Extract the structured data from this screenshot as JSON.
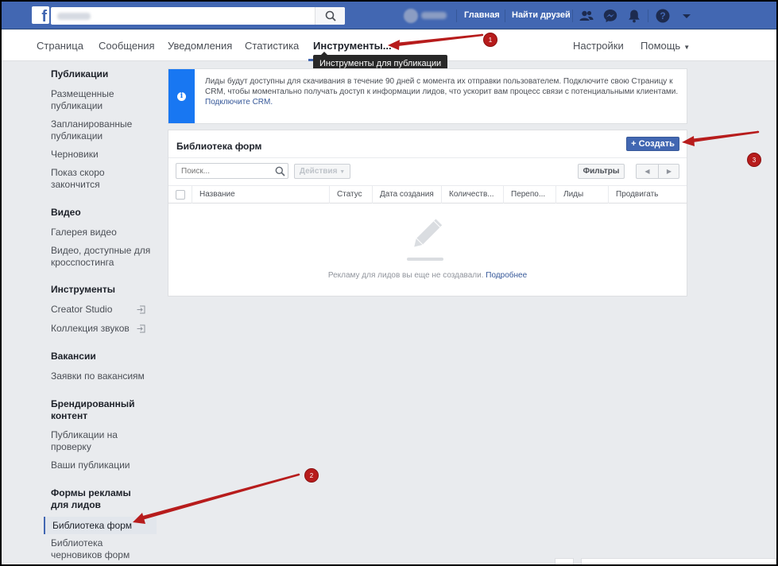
{
  "topbar": {
    "home_label": "Главная",
    "find_friends_label": "Найти друзей"
  },
  "pagenav": {
    "page": "Страница",
    "messages": "Сообщения",
    "notifications": "Уведомления",
    "stats": "Статистика",
    "tools": "Инструменты...",
    "settings": "Настройки",
    "help": "Помощь",
    "tooltip": "Инструменты для публикации"
  },
  "sidebar": {
    "publications_header": "Публикации",
    "published": "Размещенные публикации",
    "scheduled": "Запланированные публикации",
    "drafts": "Черновики",
    "expiring": "Показ скоро закончится",
    "video_header": "Видео",
    "video_gallery": "Галерея видео",
    "crossposting": "Видео, доступные для кросспостинга",
    "tools_header": "Инструменты",
    "creator_studio": "Creator Studio",
    "sound_collection": "Коллекция звуков",
    "jobs_header": "Вакансии",
    "job_applications": "Заявки по вакансиям",
    "branded_header": "Брендированный контент",
    "posts_for_review": "Публикации на проверку",
    "your_posts": "Ваши публикации",
    "lead_forms_header": "Формы рекламы для лидов",
    "forms_library": "Библиотека форм",
    "drafts_library": "Библиотека черновиков форм"
  },
  "notice": {
    "text": "Лиды будут доступны для скачивания в течение 90 дней с момента их отправки пользователем. Подключите свою Страницу к CRM, чтобы моментально получать доступ к информации лидов, что ускорит вам процесс связи с потенциальными клиентами.",
    "link": "Подключите CRM."
  },
  "forms": {
    "title": "Библиотека форм",
    "create_label": "Создать",
    "search_placeholder": "Поиск...",
    "actions_label": "Действия",
    "filters_label": "Фильтры",
    "columns": [
      "Название",
      "Статус",
      "Дата создания",
      "Количеств...",
      "Перепо...",
      "Лиды",
      "Продвигать"
    ],
    "empty_text": "Рекламу для лидов вы еще не создавали.",
    "empty_link": "Подробнее"
  },
  "annotations": {
    "badge1": "1",
    "badge2": "2",
    "badge3": "3",
    "color": "#b71c1c"
  },
  "colors": {
    "brand": "#4267b2",
    "background": "#e9ebee",
    "link": "#365899",
    "info": "#1877f2"
  }
}
